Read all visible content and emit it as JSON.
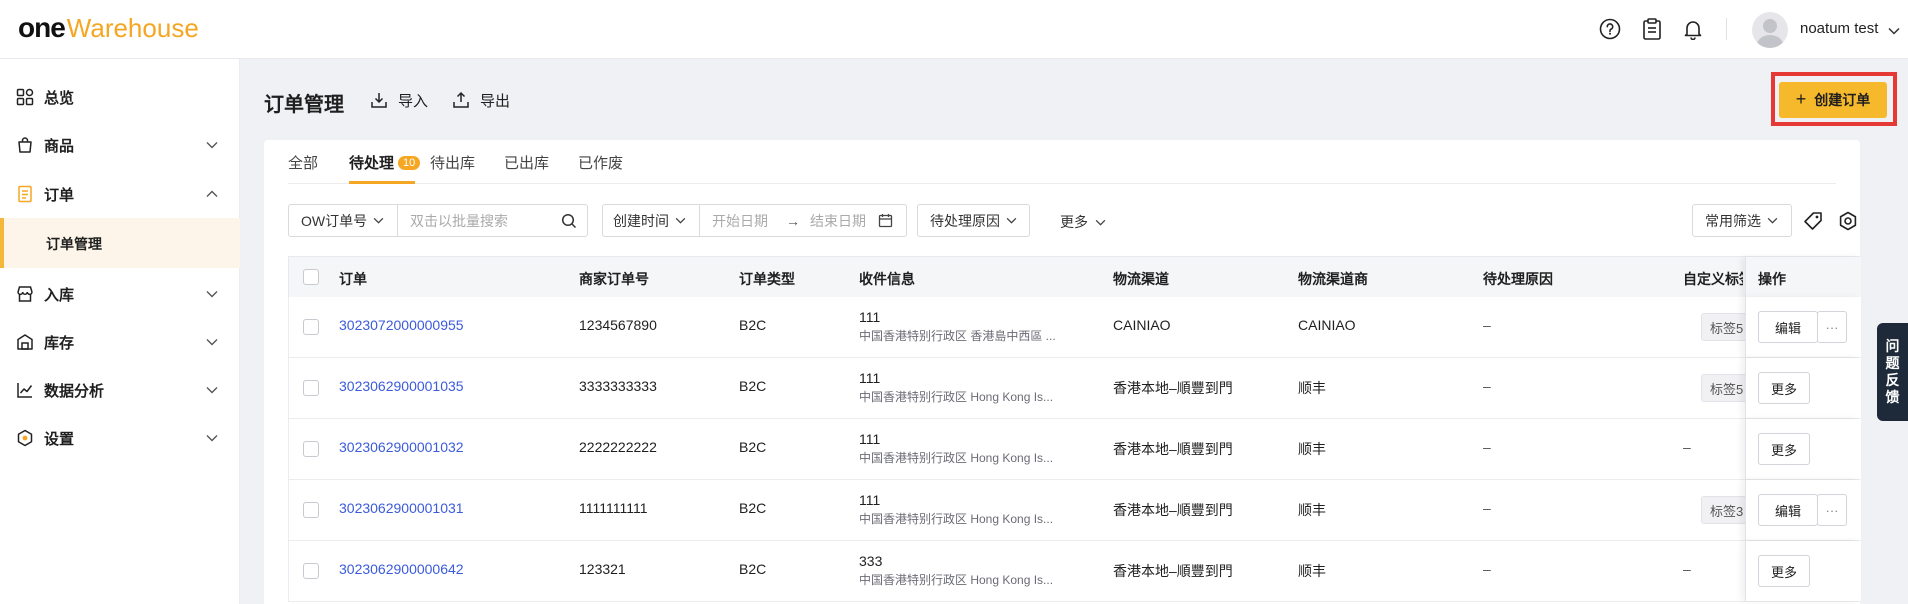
{
  "header": {
    "logo_one": "one",
    "logo_warehouse": "Warehouse",
    "username": "noatum test"
  },
  "sidebar": {
    "items": [
      {
        "label": "总览"
      },
      {
        "label": "商品"
      },
      {
        "label": "订单"
      },
      {
        "label": "入库"
      },
      {
        "label": "库存"
      },
      {
        "label": "数据分析"
      },
      {
        "label": "设置"
      }
    ],
    "active_sub": "订单管理"
  },
  "page": {
    "title": "订单管理",
    "import_label": "导入",
    "export_label": "导出",
    "create_label": "创建订单"
  },
  "tabs": [
    {
      "label": "全部"
    },
    {
      "label": "待处理",
      "badge": "10"
    },
    {
      "label": "待出库"
    },
    {
      "label": "已出库"
    },
    {
      "label": "已作废"
    }
  ],
  "filters": {
    "order_type_select": "OW订单号",
    "search_placeholder": "双击以批量搜索",
    "time_select": "创建时间",
    "start_placeholder": "开始日期",
    "end_placeholder": "结束日期",
    "reason_select": "待处理原因",
    "more": "更多",
    "common_filter": "常用筛选"
  },
  "table": {
    "columns": [
      "订单",
      "商家订单号",
      "订单类型",
      "收件信息",
      "物流渠道",
      "物流渠道商",
      "待处理原因",
      "自定义标签",
      "操作"
    ],
    "rows": [
      {
        "order": "3023072000000955",
        "merchant_no": "1234567890",
        "type": "B2C",
        "recv_name": "111",
        "recv_addr": "中国香港特别行政区 香港島中西區 ...",
        "channel": "CAINIAO",
        "carrier": "CAINIAO",
        "reason": "–",
        "tag": "标签5",
        "action": "编辑"
      },
      {
        "order": "3023062900001035",
        "merchant_no": "3333333333",
        "type": "B2C",
        "recv_name": "111",
        "recv_addr": "中国香港特别行政区 Hong Kong Is...",
        "channel": "香港本地–順豐到門",
        "carrier": "顺丰",
        "reason": "–",
        "tag": "标签5",
        "action": "更多"
      },
      {
        "order": "3023062900001032",
        "merchant_no": "2222222222",
        "type": "B2C",
        "recv_name": "111",
        "recv_addr": "中国香港特别行政区 Hong Kong Is...",
        "channel": "香港本地–順豐到門",
        "carrier": "顺丰",
        "reason": "–",
        "tag": "–",
        "action": "更多"
      },
      {
        "order": "3023062900001031",
        "merchant_no": "1111111111",
        "type": "B2C",
        "recv_name": "111",
        "recv_addr": "中国香港特别行政区 Hong Kong Is...",
        "channel": "香港本地–順豐到門",
        "carrier": "顺丰",
        "reason": "–",
        "tag": "标签3",
        "action": "编辑"
      },
      {
        "order": "3023062900000642",
        "merchant_no": "123321",
        "type": "B2C",
        "recv_name": "333",
        "recv_addr": "中国香港特别行政区 Hong Kong Is...",
        "channel": "香港本地–順豐到門",
        "carrier": "顺丰",
        "reason": "–",
        "tag": "–",
        "action": "更多"
      }
    ]
  },
  "feedback": {
    "c1": "问",
    "c2": "题",
    "c3": "反",
    "c4": "馈"
  },
  "colors": {
    "accent": "#f6b92b",
    "link": "#3b5bdb",
    "highlight": "#e53935"
  }
}
